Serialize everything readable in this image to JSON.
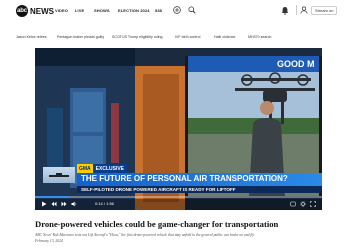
{
  "nav": {
    "logo_letters": "abc",
    "logo_text": "NEWS",
    "links": [
      "VIDEO",
      "LIVE",
      "SHOWS",
      "ELECTION 2024",
      "538"
    ],
    "stream_label": "Stream on"
  },
  "trending": [
    "Jason Kelce retires",
    "Pentagon leaker pleads guilty",
    "SCOTUS Trump eligibility ruling",
    "IVF birth control",
    "Haiti violence",
    "MH370 search"
  ],
  "video": {
    "promo_tag": "GMA",
    "exclusive_tag": "EXCLUSIVE",
    "headline": "THE FUTURE OF PERSONAL AIR TRANSPORTATION?",
    "subheadline": "SELF-PILOTED DRONE POWERED AIRCRAFT IS READY FOR LIFTOFF",
    "sign_text": "GOOD M",
    "time": "0:14 / 1:56",
    "progress_fraction": 0.12
  },
  "article": {
    "title": "Drone-powered vehicles could be game-changer for transportation",
    "caption": "ABC News' Rob Marciano tests out Lift Aircraft's \"Hexa,\" the first drone-powered vehicle that may unfold in the general public can brake on and fly.",
    "date": "February 13, 2024"
  },
  "colors": {
    "accent_blue": "#1562c9",
    "promo_yellow": "#ffcc00"
  }
}
